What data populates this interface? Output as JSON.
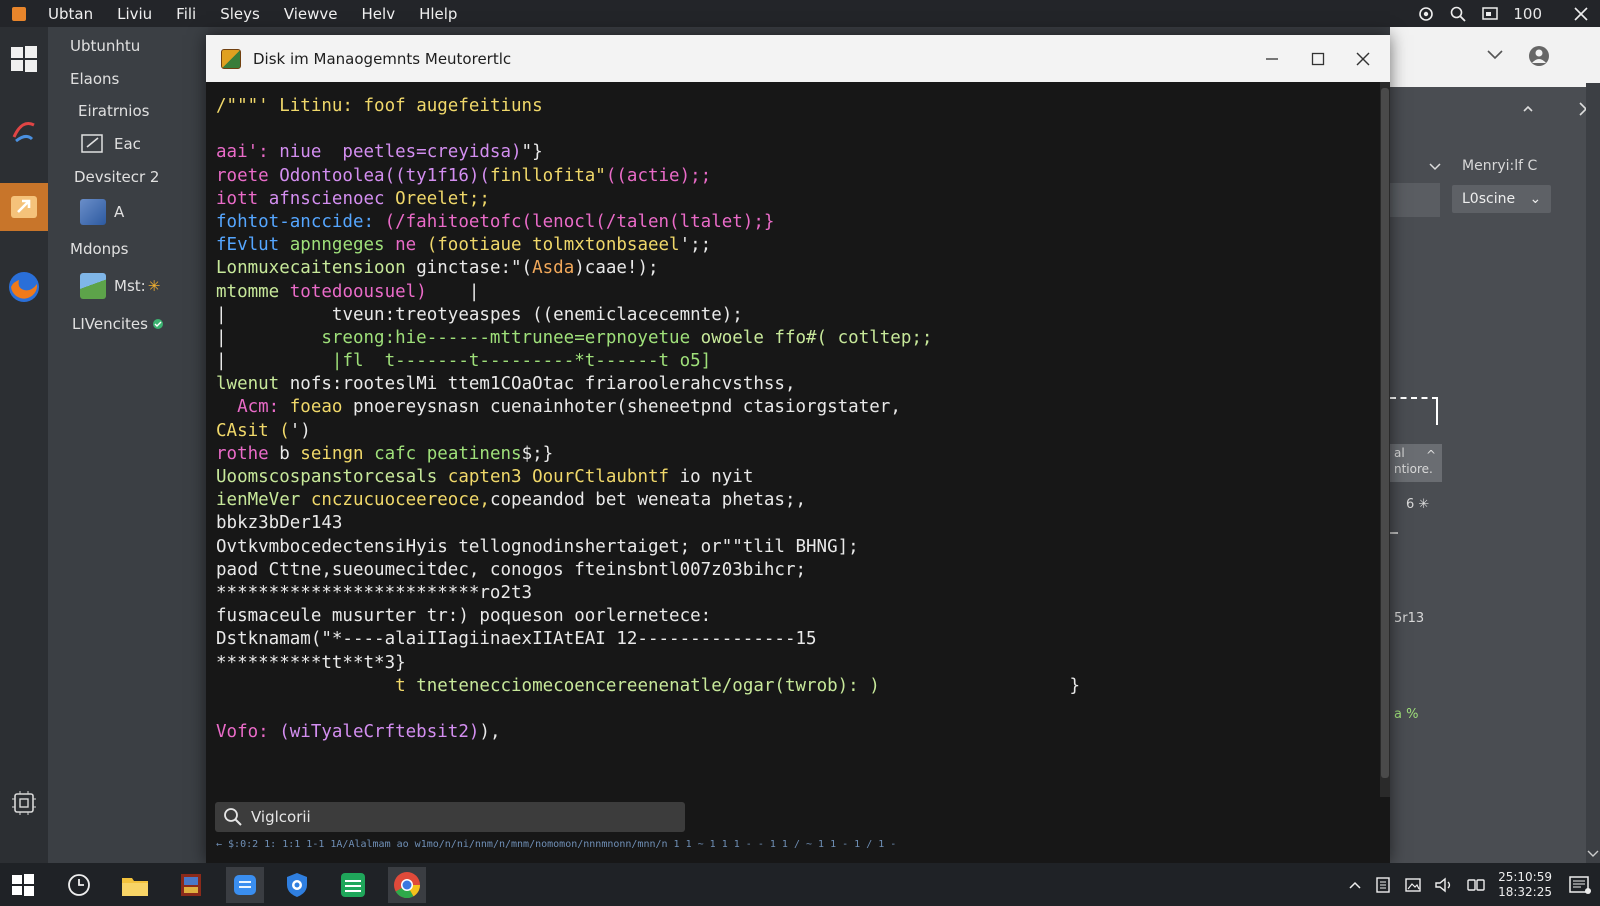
{
  "topbar": {
    "menus": [
      "Ubtan",
      "Liviu",
      "Fili",
      "Sleys",
      "Viewve",
      "Helv",
      "Hlelp"
    ],
    "zoom": "100"
  },
  "sidebar": {
    "items": [
      {
        "label": "Ubtunhtu"
      },
      {
        "label": "Elaons"
      },
      {
        "label": "Eiratrnios"
      },
      {
        "label": "Eac"
      },
      {
        "label": "Devsitecr 2"
      },
      {
        "label": "A"
      },
      {
        "label": "Mdonps"
      },
      {
        "label": "Mst:"
      },
      {
        "label": "LIVencites"
      }
    ]
  },
  "window": {
    "title": "Disk im Manaogemnts  Meutorertlc"
  },
  "terminal": {
    "lines": [
      [
        {
          "t": "/\"\"\"' Litinu: ",
          "c": "c-yellow"
        },
        {
          "t": "foof augefeitiuns",
          "c": "c-yellow"
        }
      ],
      [
        {
          "t": "",
          "c": "c-white"
        }
      ],
      [
        {
          "t": "aai': ",
          "c": "c-pink"
        },
        {
          "t": "niue  peetles=creyidsa)",
          "c": "c-purple"
        },
        {
          "t": "\"}",
          "c": "c-white"
        }
      ],
      [
        {
          "t": "roete ",
          "c": "c-pink"
        },
        {
          "t": "Odontoolea((ty1f16)(",
          "c": "c-purple"
        },
        {
          "t": "finllofita\"",
          "c": "c-yellow"
        },
        {
          "t": "((actie);;",
          "c": "c-pink"
        }
      ],
      [
        {
          "t": "iott ",
          "c": "c-pink"
        },
        {
          "t": "afnscienoec ",
          "c": "c-purple"
        },
        {
          "t": "Oreelet;;",
          "c": "c-yellow"
        }
      ],
      [
        {
          "t": "fohtot-anccide: ",
          "c": "c-blue"
        },
        {
          "t": "(/fahitoetofc(lenocl(/talen(ltalet);}",
          "c": "c-pink"
        }
      ],
      [
        {
          "t": "fEvlut ",
          "c": "c-blue"
        },
        {
          "t": "apnngeges ",
          "c": "c-green"
        },
        {
          "t": "ne ",
          "c": "c-pink"
        },
        {
          "t": "(footiaue tolmxtonbsaeel",
          "c": "c-yellow"
        },
        {
          "t": "';;",
          "c": "c-white"
        }
      ],
      [
        {
          "t": "Lonmuxecaitensioon ",
          "c": "c-lgreen"
        },
        {
          "t": "ginctase:",
          "c": "c-white"
        },
        {
          "t": "\"(",
          "c": "c-white"
        },
        {
          "t": "Asda",
          "c": "c-orange"
        },
        {
          "t": ")caae!);",
          "c": "c-white"
        }
      ],
      [
        {
          "t": "mtomme ",
          "c": "c-lgreen"
        },
        {
          "t": "totedoousuel)",
          "c": "c-pink"
        },
        {
          "t": "    |",
          "c": "c-white"
        }
      ],
      [
        {
          "t": "|          ",
          "c": "c-white"
        },
        {
          "t": "tveun:treotyeaspes ",
          "c": "c-white"
        },
        {
          "t": "((enemiclacecemnte);",
          "c": "c-white"
        }
      ],
      [
        {
          "t": "|         ",
          "c": "c-white"
        },
        {
          "t": "sreong:hie------mttrunee=erpnoyetue ",
          "c": "c-green"
        },
        {
          "t": "owoele ffo#( cotltep;;",
          "c": "c-lgreen"
        }
      ],
      [
        {
          "t": "|          ",
          "c": "c-white"
        },
        {
          "t": "|fl  t-------t---------*t------t o5]",
          "c": "c-green"
        }
      ],
      [
        {
          "t": "lwenut ",
          "c": "c-lgreen"
        },
        {
          "t": "nofs:",
          "c": "c-white"
        },
        {
          "t": "rooteslMi ttem1COaOtac friaroolerahcvsthss,",
          "c": "c-white"
        }
      ],
      [
        {
          "t": "  ",
          "c": "c-white"
        },
        {
          "t": "Acm: ",
          "c": "c-pink"
        },
        {
          "t": "foeao ",
          "c": "c-yellow"
        },
        {
          "t": "pnoereysnasn cuenainhoter(sheneetpnd ctasiorgstater,",
          "c": "c-white"
        }
      ],
      [
        {
          "t": "CAsit (",
          "c": "c-yellow"
        },
        {
          "t": "')",
          "c": "c-white"
        }
      ],
      [
        {
          "t": "rothe ",
          "c": "c-pink"
        },
        {
          "t": "b ",
          "c": "c-white"
        },
        {
          "t": "seingn ",
          "c": "c-yellow"
        },
        {
          "t": "cafc peatinens",
          "c": "c-green"
        },
        {
          "t": "$;}",
          "c": "c-white"
        }
      ],
      [
        {
          "t": "Uoomscospanstorcesals ",
          "c": "c-lgreen"
        },
        {
          "t": "capten3 ",
          "c": "c-yellow"
        },
        {
          "t": "OourCtlaubntf",
          "c": "c-yellow"
        },
        {
          "t": " io nyit",
          "c": "c-white"
        }
      ],
      [
        {
          "t": "ienMeVer ",
          "c": "c-lgreen"
        },
        {
          "t": "cnczucuoceereoce,",
          "c": "c-yellow"
        },
        {
          "t": "copeandod bet weneata phetas;,",
          "c": "c-white"
        }
      ],
      [
        {
          "t": "bbkz3bDer143",
          "c": "c-white"
        }
      ],
      [
        {
          "t": "OvtkvmbocedectensiHyis tellognodinshertaiget; or\"\"tlil BHNG];",
          "c": "c-white"
        }
      ],
      [
        {
          "t": "paod Cttne,sueoumecitdec, conogos fteinsbntl007z03bihcr;",
          "c": "c-white"
        }
      ],
      [
        {
          "t": "*************************ro2t3",
          "c": "c-white"
        }
      ],
      [
        {
          "t": "fusmaceule musurter tr:) ",
          "c": "c-white"
        },
        {
          "t": "poqueson oorlernetece:",
          "c": "c-white"
        }
      ],
      [
        {
          "t": "Dstknamam(\"*----alaiIIagiinaexIIAtEAI 12---------------15",
          "c": "c-white"
        }
      ],
      [
        {
          "t": "**********tt**t*3}",
          "c": "c-white"
        }
      ],
      [
        {
          "t": "                 ",
          "c": "c-white"
        },
        {
          "t": "t ",
          "c": "c-yellow"
        },
        {
          "t": "tnetenecciomecoencereenenatle/ogar(twrob): )",
          "c": "c-lgreen"
        },
        {
          "t": "                  }",
          "c": "c-white"
        }
      ],
      [
        {
          "t": "",
          "c": "c-white"
        }
      ],
      [
        {
          "t": "Vofo: ",
          "c": "c-pink"
        },
        {
          "t": "(wiTyaleCrftebsit2)",
          "c": "c-purple"
        },
        {
          "t": "),",
          "c": "c-white"
        }
      ]
    ]
  },
  "search": {
    "placeholder": "Viglcorii"
  },
  "status_line": "←  $:0:2    1: 1:1 1-1   1A/Alalmam  ao  w1mo/n/ni/nnm/n/mnm/nomomon/nnnmnonn/mnn/n   1   1   ~   1   1  1   -   -   1   1  /    ~  1  1   -   1   /  1  -",
  "right_panel": {
    "dropdown_label": "Menryi:lf C",
    "chip_label": "L0scine",
    "note_lines": [
      "al",
      "ntiore."
    ],
    "small_value_1": "6",
    "small_value_2": "5r13",
    "small_value_3": "a %"
  },
  "taskbar": {
    "clock_time": "25:10:59",
    "clock_date": "18:32:25"
  }
}
